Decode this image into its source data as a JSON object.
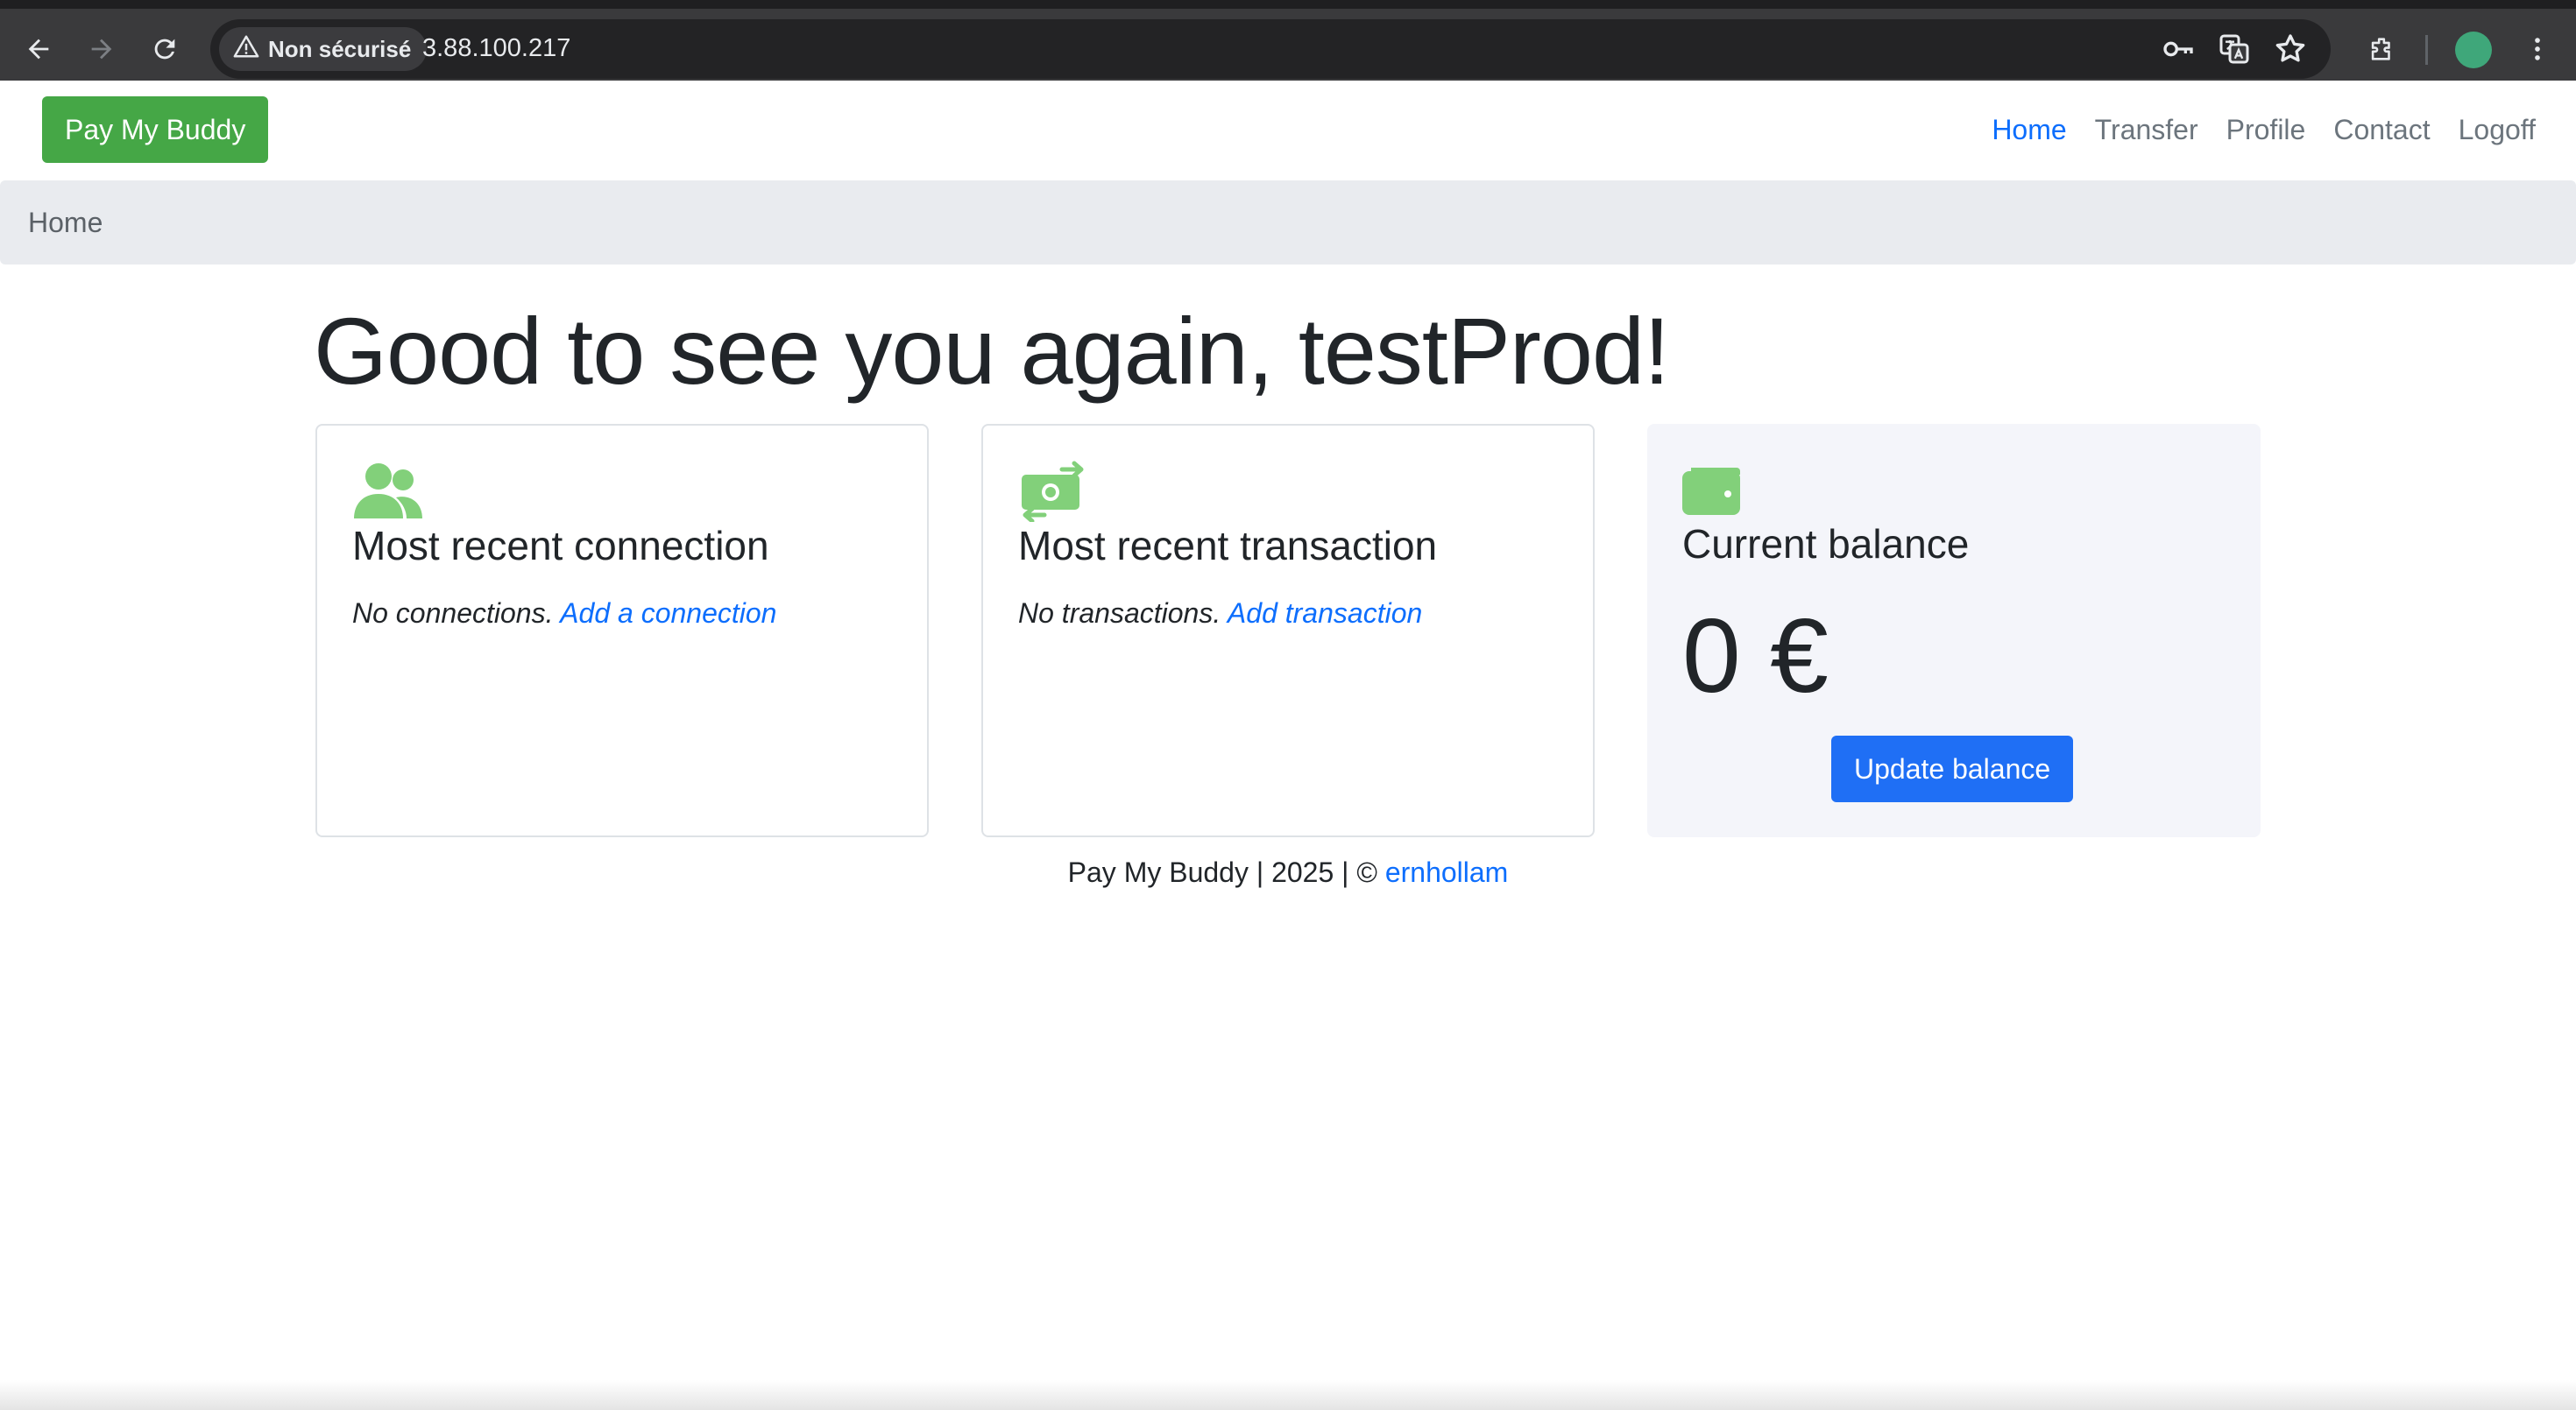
{
  "browser": {
    "security_label": "Non sécurisé",
    "url": "3.88.100.217",
    "icons": [
      "back-arrow-icon",
      "forward-arrow-icon",
      "reload-icon",
      "warning-icon",
      "key-icon",
      "translate-icon",
      "star-icon",
      "extensions-icon",
      "profile-avatar",
      "kebab-menu-icon"
    ]
  },
  "navbar": {
    "brand": "Pay My Buddy",
    "links": [
      {
        "label": "Home",
        "active": true
      },
      {
        "label": "Transfer",
        "active": false
      },
      {
        "label": "Profile",
        "active": false
      },
      {
        "label": "Contact",
        "active": false
      },
      {
        "label": "Logoff",
        "active": false
      }
    ]
  },
  "breadcrumb": {
    "current": "Home"
  },
  "main": {
    "greeting": "Good to see you again, testProd!",
    "cards": {
      "connection": {
        "icon": "users-icon",
        "title": "Most recent connection",
        "empty_text": "No connections.",
        "link": "Add a connection"
      },
      "transaction": {
        "icon": "money-transfer-icon",
        "title": "Most recent transaction",
        "empty_text": "No transactions.",
        "link": "Add transaction"
      },
      "balance": {
        "icon": "wallet-icon",
        "title": "Current balance",
        "amount": "0 €",
        "button": "Update balance"
      }
    }
  },
  "footer": {
    "text": "Pay My Buddy | 2025 | ©",
    "author": "ernhollam"
  },
  "colors": {
    "brand_green": "#45a746",
    "icon_green": "#82d07a",
    "link_blue": "#0d6efd",
    "button_blue": "#1f6ff5"
  }
}
